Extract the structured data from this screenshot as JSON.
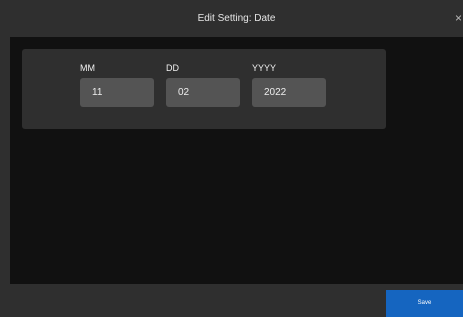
{
  "header": {
    "title": "Edit Setting: Date",
    "close_icon": "close-icon",
    "close_glyph": "×"
  },
  "date": {
    "month": {
      "label": "MM",
      "value": "11"
    },
    "day": {
      "label": "DD",
      "value": "02"
    },
    "year": {
      "label": "YYYY",
      "value": "2022"
    }
  },
  "footer": {
    "save_label": "Save"
  },
  "colors": {
    "background": "#111111",
    "panel": "#2f2f2f",
    "input": "#545454",
    "accent": "#1565c0"
  }
}
